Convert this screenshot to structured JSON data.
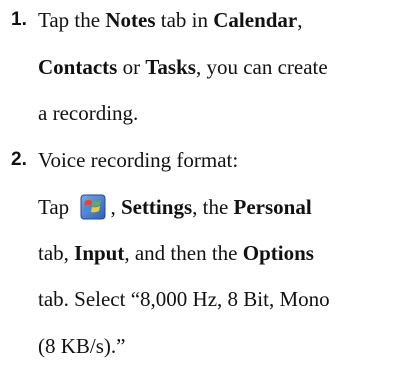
{
  "steps": [
    {
      "number": "1.",
      "text": {
        "a": "Tap the ",
        "b": "Notes",
        "c": " tab in ",
        "d": "Calendar",
        "e": ",",
        "f": "Contacts",
        "g": " or ",
        "h": "Tasks",
        "i": ", you can create",
        "j": "a recording."
      }
    },
    {
      "number": "2.",
      "text": {
        "a": "Voice recording format:",
        "b": "Tap ",
        "c": ", ",
        "d": "Settings",
        "e": ", the ",
        "f": "Personal",
        "g": "tab, ",
        "h": "Input",
        "i": ", and then the ",
        "j": "Options",
        "k": "tab. Select “8,000 Hz, 8 Bit, Mono",
        "l": "(8 KB/s).”"
      }
    }
  ],
  "icons": {
    "start": "windows-start-flag-icon"
  }
}
